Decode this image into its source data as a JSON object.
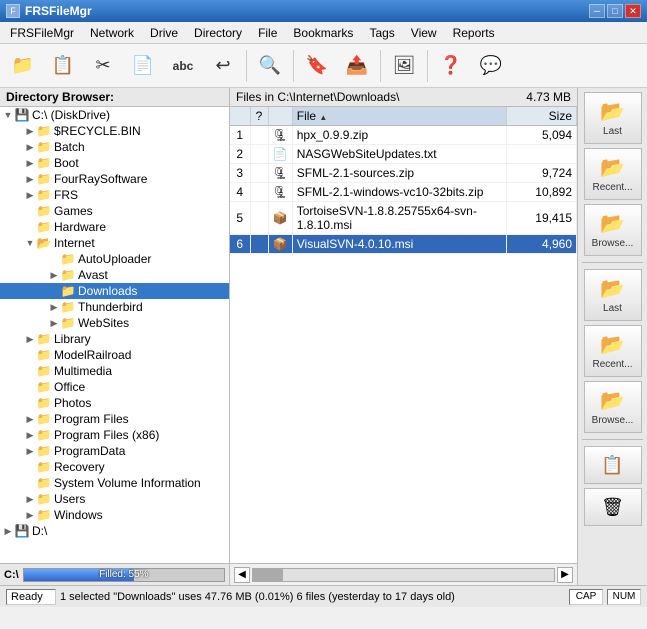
{
  "titleBar": {
    "title": "FRSFileMgr",
    "controls": {
      "minimize": "─",
      "maximize": "□",
      "close": "✕"
    }
  },
  "menuBar": {
    "items": [
      "FRSFileMgr",
      "Network",
      "Drive",
      "Directory",
      "File",
      "Bookmarks",
      "Tags",
      "View",
      "Reports"
    ]
  },
  "toolbar": {
    "buttons": [
      {
        "name": "open-folder-btn",
        "icon": "📁",
        "label": ""
      },
      {
        "name": "copy-btn",
        "icon": "📋",
        "label": ""
      },
      {
        "name": "cut-btn",
        "icon": "✂",
        "label": ""
      },
      {
        "name": "paste-btn",
        "icon": "📄",
        "label": ""
      },
      {
        "name": "rename-btn",
        "icon": "Abc",
        "label": ""
      },
      {
        "name": "undo-btn",
        "icon": "↩",
        "label": ""
      },
      {
        "name": "sep1",
        "icon": "",
        "label": ""
      },
      {
        "name": "browse-btn",
        "icon": "🔍",
        "label": ""
      },
      {
        "name": "sep2",
        "icon": "",
        "label": ""
      },
      {
        "name": "bookmark-btn",
        "icon": "🔖",
        "label": ""
      },
      {
        "name": "copy2-btn",
        "icon": "📤",
        "label": ""
      },
      {
        "name": "sep3",
        "icon": "",
        "label": ""
      },
      {
        "name": "img-btn",
        "icon": "🖼",
        "label": ""
      },
      {
        "name": "sep4",
        "icon": "",
        "label": ""
      },
      {
        "name": "help-btn",
        "icon": "❓",
        "label": ""
      },
      {
        "name": "comment-btn",
        "icon": "💬",
        "label": ""
      }
    ]
  },
  "dirPanel": {
    "header": "Directory Browser:",
    "tree": [
      {
        "id": "c-drive",
        "label": "C:\\  (DiskDrive)",
        "level": 0,
        "type": "hdd",
        "expanded": true,
        "children": [
          {
            "id": "recycle",
            "label": "$RECYCLE.BIN",
            "level": 1,
            "type": "folder",
            "expanded": false
          },
          {
            "id": "batch",
            "label": "Batch",
            "level": 1,
            "type": "folder",
            "expanded": false
          },
          {
            "id": "boot",
            "label": "Boot",
            "level": 1,
            "type": "folder",
            "expanded": false
          },
          {
            "id": "fourray",
            "label": "FourRaySoftware",
            "level": 1,
            "type": "folder",
            "expanded": false
          },
          {
            "id": "frs",
            "label": "FRS",
            "level": 1,
            "type": "folder",
            "expanded": false
          },
          {
            "id": "games",
            "label": "Games",
            "level": 1,
            "type": "folder",
            "expanded": false
          },
          {
            "id": "hardware",
            "label": "Hardware",
            "level": 1,
            "type": "folder",
            "expanded": false
          },
          {
            "id": "internet",
            "label": "Internet",
            "level": 1,
            "type": "folder",
            "expanded": true,
            "children": [
              {
                "id": "autouploader",
                "label": "AutoUploader",
                "level": 2,
                "type": "folder",
                "expanded": false
              },
              {
                "id": "avast",
                "label": "Avast",
                "level": 2,
                "type": "folder",
                "expanded": false
              },
              {
                "id": "downloads",
                "label": "Downloads",
                "level": 2,
                "type": "folder",
                "expanded": false,
                "selected": true
              },
              {
                "id": "thunderbird",
                "label": "Thunderbird",
                "level": 2,
                "type": "folder",
                "expanded": false
              },
              {
                "id": "websites",
                "label": "WebSites",
                "level": 2,
                "type": "folder",
                "expanded": false
              }
            ]
          },
          {
            "id": "library",
            "label": "Library",
            "level": 1,
            "type": "folder",
            "expanded": false
          },
          {
            "id": "modelrailroad",
            "label": "ModelRailroad",
            "level": 1,
            "type": "folder",
            "expanded": false
          },
          {
            "id": "multimedia",
            "label": "Multimedia",
            "level": 1,
            "type": "folder",
            "expanded": false
          },
          {
            "id": "office",
            "label": "Office",
            "level": 1,
            "type": "folder",
            "expanded": false
          },
          {
            "id": "photos",
            "label": "Photos",
            "level": 1,
            "type": "folder",
            "expanded": false
          },
          {
            "id": "programfiles",
            "label": "Program Files",
            "level": 1,
            "type": "folder",
            "expanded": false
          },
          {
            "id": "programfilesx86",
            "label": "Program Files (x86)",
            "level": 1,
            "type": "folder",
            "expanded": false
          },
          {
            "id": "programdata",
            "label": "ProgramData",
            "level": 1,
            "type": "folder",
            "expanded": false
          },
          {
            "id": "recovery",
            "label": "Recovery",
            "level": 1,
            "type": "folder",
            "expanded": false
          },
          {
            "id": "sysvolinfo",
            "label": "System Volume Information",
            "level": 1,
            "type": "folder",
            "expanded": false
          },
          {
            "id": "users",
            "label": "Users",
            "level": 1,
            "type": "folder",
            "expanded": false
          },
          {
            "id": "windows",
            "label": "Windows",
            "level": 1,
            "type": "folder",
            "expanded": false
          }
        ]
      },
      {
        "id": "d-drive",
        "label": "D:\\",
        "level": 0,
        "type": "hdd",
        "expanded": false
      }
    ]
  },
  "diskBar": {
    "drive": "C:\\",
    "label": "Filled:",
    "percent": 55,
    "percentText": "55%"
  },
  "filesPanel": {
    "header": "Files in C:\\Internet\\Downloads\\",
    "totalSize": "4.73 MB",
    "columns": [
      {
        "id": "num",
        "label": ""
      },
      {
        "id": "check",
        "label": "?"
      },
      {
        "id": "type",
        "label": ""
      },
      {
        "id": "file",
        "label": "File",
        "sortActive": true,
        "sortDir": "asc"
      },
      {
        "id": "size",
        "label": "Size"
      }
    ],
    "files": [
      {
        "num": "1",
        "check": "",
        "type": "zip",
        "name": "hpx_0.9.9.zip",
        "size": "5,094",
        "selected": false
      },
      {
        "num": "2",
        "check": "",
        "type": "txt",
        "name": "NASGWebSiteUpdates.txt",
        "size": "",
        "selected": false
      },
      {
        "num": "3",
        "check": "",
        "type": "zip",
        "name": "SFML-2.1-sources.zip",
        "size": "9,724",
        "selected": false
      },
      {
        "num": "4",
        "check": "",
        "type": "zip",
        "name": "SFML-2.1-windows-vc10-32bits.zip",
        "size": "10,892",
        "selected": false
      },
      {
        "num": "5",
        "check": "",
        "type": "msi",
        "name": "TortoiseSVN-1.8.8.25755x64-svn-1.8.10.msi",
        "size": "19,415",
        "selected": false
      },
      {
        "num": "6",
        "check": "",
        "type": "msi",
        "name": "VisualSVN-4.0.10.msi",
        "size": "4,960",
        "selected": true
      }
    ]
  },
  "rightPanel": {
    "buttons": [
      {
        "name": "last-btn-top",
        "icon": "📂",
        "label": "Last"
      },
      {
        "name": "recent-btn-top",
        "icon": "📂",
        "label": "Recent..."
      },
      {
        "name": "browse-btn-top",
        "icon": "📂",
        "label": "Browse..."
      },
      {
        "name": "last-btn-bottom",
        "icon": "📂",
        "label": "Last"
      },
      {
        "name": "recent-btn-bottom",
        "icon": "📂",
        "label": "Recent..."
      },
      {
        "name": "browse-btn-bottom",
        "icon": "📂",
        "label": "Browse..."
      },
      {
        "name": "copy-right-btn",
        "icon": "📋",
        "label": ""
      },
      {
        "name": "delete-btn",
        "icon": "🗑",
        "label": ""
      }
    ]
  },
  "statusBar": {
    "ready": "Ready",
    "message": "1 selected   \"Downloads\" uses 47.76 MB (0.01%)   6 files (yesterday to 17 days old)",
    "caps": "CAP",
    "num": "NUM"
  }
}
